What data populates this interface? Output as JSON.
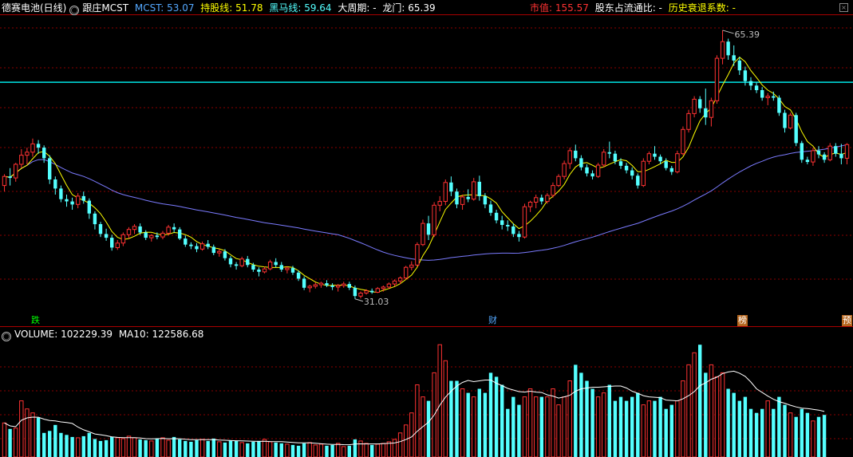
{
  "header": {
    "stock_name": "德赛电池(日线)",
    "indicator_name": "跟庄MCST",
    "mcst": "MCST: 53.07",
    "hold_line": "持股线: 51.78",
    "dark_horse": "黑马线: 59.64",
    "cycle": "大周期: -",
    "dragon_gate": "龙门: 65.39",
    "market_value": "市值: 155.57",
    "float_ratio": "股东占流通比: -",
    "decay": "历史衰退系数: -"
  },
  "volume_header": {
    "volume": "VOLUME: 102229.39",
    "ma10": "MA10: 122586.68"
  },
  "markers": [
    "跌",
    "财",
    "榜",
    "预"
  ],
  "annotations": {
    "high": "65.39",
    "low": "31.03"
  },
  "colors": {
    "up": "#ff3232",
    "down": "#54ffff",
    "ma_short": "#ffff00",
    "ma_long": "#7b7bff",
    "resistance": "#00e5e5",
    "grid": "#8b0000",
    "vol_ma": "#ffffff"
  },
  "chart_data": {
    "type": "candlestick",
    "price_range": [
      28.9,
      68.6
    ],
    "resistance_level": 59.64,
    "candles": [
      [
        46.0,
        47.5,
        45.2,
        47.2
      ],
      [
        47.2,
        48.3,
        46.0,
        47.0
      ],
      [
        47.0,
        49.0,
        46.5,
        48.8
      ],
      [
        48.8,
        50.8,
        48.3,
        50.0
      ],
      [
        50.0,
        51.0,
        48.8,
        50.4
      ],
      [
        50.4,
        52.2,
        49.8,
        51.5
      ],
      [
        51.5,
        52.0,
        50.2,
        51.0
      ],
      [
        51.0,
        51.3,
        49.0,
        49.6
      ],
      [
        49.6,
        50.0,
        46.2,
        46.8
      ],
      [
        46.8,
        47.2,
        44.8,
        45.6
      ],
      [
        45.6,
        46.0,
        43.8,
        44.2
      ],
      [
        44.2,
        44.8,
        43.2,
        43.9
      ],
      [
        43.9,
        44.4,
        42.8,
        43.5
      ],
      [
        43.5,
        45.0,
        43.0,
        44.6
      ],
      [
        44.6,
        45.2,
        43.6,
        44.0
      ],
      [
        44.0,
        44.3,
        41.6,
        42.3
      ],
      [
        42.3,
        42.6,
        40.2,
        40.9
      ],
      [
        40.9,
        41.2,
        39.2,
        39.6
      ],
      [
        39.6,
        40.3,
        38.7,
        39.1
      ],
      [
        39.1,
        39.5,
        37.4,
        37.8
      ],
      [
        37.8,
        38.8,
        37.5,
        38.4
      ],
      [
        38.4,
        39.8,
        38.0,
        39.5
      ],
      [
        39.5,
        40.5,
        39.0,
        40.2
      ],
      [
        40.2,
        40.9,
        39.6,
        40.6
      ],
      [
        40.6,
        41.0,
        39.5,
        39.8
      ],
      [
        39.8,
        40.1,
        38.8,
        39.1
      ],
      [
        39.1,
        39.6,
        38.6,
        39.4
      ],
      [
        39.4,
        39.8,
        38.9,
        39.2
      ],
      [
        39.2,
        40.0,
        38.9,
        39.7
      ],
      [
        39.7,
        40.8,
        39.4,
        40.5
      ],
      [
        40.5,
        41.0,
        39.8,
        40.2
      ],
      [
        40.2,
        40.5,
        38.8,
        39.0
      ],
      [
        39.0,
        39.4,
        37.9,
        38.2
      ],
      [
        38.2,
        38.5,
        37.6,
        38.0
      ],
      [
        38.0,
        38.4,
        37.2,
        37.6
      ],
      [
        37.6,
        38.6,
        37.4,
        38.3
      ],
      [
        38.3,
        38.8,
        37.6,
        37.9
      ],
      [
        37.9,
        38.2,
        36.8,
        37.1
      ],
      [
        37.1,
        37.6,
        36.6,
        37.3
      ],
      [
        37.3,
        37.6,
        36.1,
        36.4
      ],
      [
        36.4,
        36.7,
        35.2,
        35.6
      ],
      [
        35.6,
        35.9,
        34.9,
        35.4
      ],
      [
        35.4,
        36.6,
        35.2,
        36.3
      ],
      [
        36.3,
        36.7,
        35.2,
        35.5
      ],
      [
        35.5,
        35.8,
        34.6,
        34.9
      ],
      [
        34.9,
        35.2,
        34.0,
        34.6
      ],
      [
        34.6,
        35.3,
        34.4,
        35.0
      ],
      [
        35.0,
        36.2,
        34.8,
        35.9
      ],
      [
        35.9,
        36.4,
        35.2,
        35.5
      ],
      [
        35.5,
        35.9,
        34.6,
        34.9
      ],
      [
        34.9,
        35.3,
        34.4,
        35.1
      ],
      [
        35.1,
        35.4,
        34.2,
        34.5
      ],
      [
        34.5,
        34.8,
        33.4,
        33.7
      ],
      [
        33.7,
        34.0,
        32.2,
        32.5
      ],
      [
        32.5,
        32.9,
        31.9,
        32.7
      ],
      [
        32.7,
        33.2,
        32.4,
        32.9
      ],
      [
        32.9,
        33.3,
        32.5,
        33.1
      ],
      [
        33.1,
        33.5,
        32.6,
        32.8
      ],
      [
        32.8,
        33.1,
        32.2,
        32.6
      ],
      [
        32.6,
        33.0,
        32.0,
        32.8
      ],
      [
        32.8,
        33.3,
        32.5,
        33.0
      ],
      [
        33.0,
        33.3,
        32.2,
        32.5
      ],
      [
        32.5,
        32.8,
        31.03,
        31.4
      ],
      [
        31.4,
        32.0,
        31.1,
        31.8
      ],
      [
        31.8,
        32.3,
        31.6,
        32.1
      ],
      [
        32.1,
        32.4,
        31.7,
        31.9
      ],
      [
        31.9,
        32.6,
        31.8,
        32.4
      ],
      [
        32.4,
        32.8,
        32.0,
        32.6
      ],
      [
        32.6,
        33.2,
        32.4,
        33.0
      ],
      [
        33.0,
        33.6,
        32.7,
        33.4
      ],
      [
        33.4,
        34.0,
        33.0,
        33.8
      ],
      [
        33.8,
        35.4,
        33.6,
        35.2
      ],
      [
        35.2,
        36.0,
        34.8,
        35.5
      ],
      [
        35.5,
        38.5,
        35.3,
        38.2
      ],
      [
        38.2,
        41.5,
        38.0,
        41.0
      ],
      [
        41.0,
        42.0,
        38.8,
        39.5
      ],
      [
        39.5,
        43.8,
        39.2,
        43.4
      ],
      [
        43.4,
        44.6,
        42.6,
        43.9
      ],
      [
        43.9,
        46.8,
        43.4,
        46.4
      ],
      [
        46.4,
        47.2,
        44.6,
        45.2
      ],
      [
        45.2,
        45.6,
        43.0,
        43.5
      ],
      [
        43.5,
        44.8,
        42.8,
        44.5
      ],
      [
        44.5,
        45.5,
        43.8,
        44.2
      ],
      [
        44.2,
        47.0,
        44.0,
        46.5
      ],
      [
        46.5,
        47.3,
        44.0,
        44.6
      ],
      [
        44.6,
        45.0,
        43.0,
        43.5
      ],
      [
        43.5,
        44.0,
        42.0,
        42.4
      ],
      [
        42.4,
        42.8,
        41.0,
        41.4
      ],
      [
        41.4,
        42.0,
        40.2,
        40.8
      ],
      [
        40.8,
        41.4,
        40.0,
        40.6
      ],
      [
        40.6,
        41.0,
        39.2,
        39.6
      ],
      [
        39.6,
        40.0,
        38.6,
        39.2
      ],
      [
        39.2,
        43.6,
        39.0,
        43.2
      ],
      [
        43.2,
        44.0,
        42.5,
        43.8
      ],
      [
        43.8,
        44.8,
        43.0,
        44.4
      ],
      [
        44.4,
        44.8,
        43.5,
        43.9
      ],
      [
        43.9,
        45.0,
        43.6,
        44.7
      ],
      [
        44.7,
        46.4,
        44.4,
        46.0
      ],
      [
        46.0,
        47.5,
        45.8,
        47.2
      ],
      [
        47.2,
        49.3,
        46.8,
        48.9
      ],
      [
        48.9,
        51.0,
        48.2,
        50.6
      ],
      [
        50.6,
        51.4,
        49.2,
        49.6
      ],
      [
        49.6,
        50.0,
        48.0,
        48.4
      ],
      [
        48.4,
        48.8,
        47.2,
        47.6
      ],
      [
        47.6,
        48.0,
        46.8,
        47.2
      ],
      [
        47.2,
        49.0,
        47.0,
        48.7
      ],
      [
        48.7,
        50.8,
        48.4,
        50.4
      ],
      [
        50.4,
        51.8,
        49.6,
        50.2
      ],
      [
        50.2,
        50.6,
        48.8,
        49.2
      ],
      [
        49.2,
        49.6,
        48.2,
        48.6
      ],
      [
        48.6,
        49.0,
        47.6,
        48.0
      ],
      [
        48.0,
        48.4,
        46.8,
        47.3
      ],
      [
        47.3,
        47.6,
        45.6,
        46.0
      ],
      [
        46.0,
        49.6,
        45.8,
        49.2
      ],
      [
        49.2,
        50.5,
        48.8,
        50.2
      ],
      [
        50.2,
        51.2,
        49.4,
        49.8
      ],
      [
        49.8,
        50.1,
        48.8,
        49.2
      ],
      [
        49.2,
        49.6,
        48.0,
        48.3
      ],
      [
        48.3,
        48.6,
        47.4,
        47.8
      ],
      [
        47.8,
        50.6,
        47.6,
        50.2
      ],
      [
        50.2,
        53.8,
        50.0,
        53.4
      ],
      [
        53.4,
        56.0,
        53.0,
        55.5
      ],
      [
        55.5,
        57.8,
        55.0,
        57.4
      ],
      [
        57.4,
        57.8,
        55.6,
        56.2
      ],
      [
        56.2,
        58.8,
        54.0,
        55.0
      ],
      [
        55.0,
        57.6,
        53.8,
        57.2
      ],
      [
        57.2,
        63.2,
        56.8,
        62.8
      ],
      [
        62.8,
        66.5,
        62.0,
        65.0
      ],
      [
        65.0,
        65.39,
        62.6,
        63.2
      ],
      [
        63.2,
        64.5,
        61.8,
        62.5
      ],
      [
        62.5,
        63.0,
        60.6,
        61.2
      ],
      [
        61.2,
        61.7,
        59.2,
        59.8
      ],
      [
        59.8,
        60.3,
        58.6,
        59.2
      ],
      [
        59.2,
        59.6,
        58.2,
        58.6
      ],
      [
        58.6,
        59.0,
        57.2,
        57.6
      ],
      [
        57.6,
        58.2,
        56.6,
        57.8
      ],
      [
        57.8,
        58.4,
        57.2,
        57.6
      ],
      [
        57.6,
        57.9,
        55.2,
        55.6
      ],
      [
        55.6,
        56.0,
        53.0,
        53.6
      ],
      [
        53.6,
        55.6,
        53.4,
        55.3
      ],
      [
        55.3,
        55.6,
        51.2,
        51.6
      ],
      [
        51.6,
        51.9,
        49.0,
        49.4
      ],
      [
        49.4,
        49.8,
        48.8,
        49.1
      ],
      [
        49.1,
        51.0,
        48.6,
        50.6
      ],
      [
        50.6,
        51.2,
        49.6,
        50.1
      ],
      [
        50.1,
        50.4,
        49.0,
        49.4
      ],
      [
        49.4,
        51.6,
        49.2,
        51.2
      ],
      [
        51.2,
        51.6,
        49.8,
        50.2
      ],
      [
        50.2,
        51.5,
        48.8,
        49.6
      ],
      [
        49.6,
        51.6,
        48.8,
        51.4
      ]
    ],
    "volumes": [
      85,
      70,
      72,
      140,
      120,
      110,
      98,
      60,
      65,
      80,
      60,
      55,
      50,
      48,
      52,
      60,
      45,
      40,
      42,
      50,
      48,
      46,
      52,
      48,
      44,
      42,
      40,
      46,
      48,
      42,
      50,
      44,
      40,
      38,
      42,
      44,
      40,
      46,
      38,
      36,
      42,
      40,
      36,
      34,
      38,
      40,
      44,
      38,
      36,
      34,
      32,
      30,
      28,
      34,
      36,
      30,
      32,
      28,
      30,
      34,
      26,
      28,
      44,
      40,
      34,
      30,
      32,
      34,
      38,
      44,
      60,
      80,
      110,
      180,
      150,
      140,
      210,
      280,
      240,
      190,
      190,
      170,
      160,
      150,
      170,
      160,
      210,
      200,
      180,
      120,
      150,
      130,
      150,
      170,
      150,
      150,
      150,
      170,
      130,
      150,
      190,
      230,
      210,
      190,
      170,
      150,
      160,
      180,
      140,
      150,
      140,
      150,
      160,
      130,
      140,
      140,
      150,
      120,
      130,
      140,
      190,
      230,
      260,
      280,
      210,
      230,
      200,
      210,
      170,
      160,
      140,
      150,
      120,
      110,
      120,
      140,
      120,
      150,
      130,
      110,
      100,
      120,
      110,
      90,
      100,
      105
    ]
  }
}
